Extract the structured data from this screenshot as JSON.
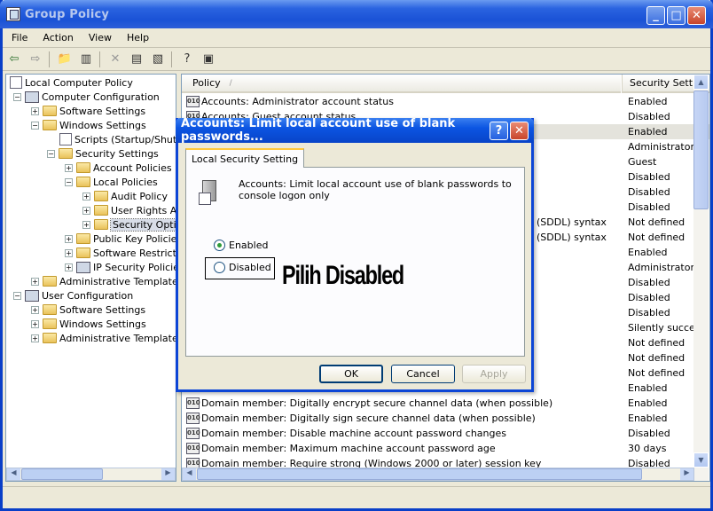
{
  "window": {
    "title": "Group Policy"
  },
  "menu": [
    "File",
    "Action",
    "View",
    "Help"
  ],
  "tree": [
    {
      "label": "Local Computer Policy",
      "icon": "policy-icon"
    },
    {
      "label": "Computer Configuration",
      "icon": "computer-icon"
    },
    {
      "label": "Software Settings",
      "icon": "folder-icon"
    },
    {
      "label": "Windows Settings",
      "icon": "folder-icon"
    },
    {
      "label": "Scripts (Startup/Shutdo",
      "icon": "scripts-icon"
    },
    {
      "label": "Security Settings",
      "icon": "security-folder-icon"
    },
    {
      "label": "Account Policies",
      "icon": "folder-icon"
    },
    {
      "label": "Local Policies",
      "icon": "folder-icon"
    },
    {
      "label": "Audit Policy",
      "icon": "folder-icon"
    },
    {
      "label": "User Rights Ass",
      "icon": "folder-icon"
    },
    {
      "label": "Security Option",
      "icon": "folder-icon"
    },
    {
      "label": "Public Key Policies",
      "icon": "folder-icon"
    },
    {
      "label": "Software Restrictic",
      "icon": "folder-icon"
    },
    {
      "label": "IP Security Policies",
      "icon": "ip-security-icon"
    },
    {
      "label": "Administrative Templates",
      "icon": "folder-icon"
    },
    {
      "label": "User Configuration",
      "icon": "user-icon"
    },
    {
      "label": "Software Settings",
      "icon": "folder-icon"
    },
    {
      "label": "Windows Settings",
      "icon": "folder-icon"
    },
    {
      "label": "Administrative Templates",
      "icon": "folder-icon"
    }
  ],
  "list": {
    "col_policy": "Policy",
    "col_setting": "Security Settin",
    "rows": [
      {
        "policy": "Accounts: Administrator account status",
        "setting": "Enabled"
      },
      {
        "policy": "Accounts: Guest account status",
        "setting": "Disabled"
      },
      {
        "policy": "",
        "setting": "Enabled"
      },
      {
        "policy": "",
        "setting": "Administrator"
      },
      {
        "policy": "",
        "setting": "Guest"
      },
      {
        "policy": "",
        "setting": "Disabled"
      },
      {
        "policy": "",
        "setting": "Disabled"
      },
      {
        "policy": "",
        "setting": "Disabled"
      },
      {
        "policy": "(SDDL) syntax",
        "setting": "Not defined"
      },
      {
        "policy": "(SDDL) syntax",
        "setting": "Not defined"
      },
      {
        "policy": "",
        "setting": "Enabled"
      },
      {
        "policy": "",
        "setting": "Administrators"
      },
      {
        "policy": "",
        "setting": "Disabled"
      },
      {
        "policy": "",
        "setting": "Disabled"
      },
      {
        "policy": "",
        "setting": "Disabled"
      },
      {
        "policy": "",
        "setting": "Silently succeed"
      },
      {
        "policy": "",
        "setting": "Not defined"
      },
      {
        "policy": "",
        "setting": "Not defined"
      },
      {
        "policy": "",
        "setting": "Not defined"
      },
      {
        "policy": "",
        "setting": "Enabled"
      },
      {
        "policy": "Domain member: Digitally encrypt secure channel data (when possible)",
        "setting": "Enabled"
      },
      {
        "policy": "Domain member: Digitally sign secure channel data (when possible)",
        "setting": "Enabled"
      },
      {
        "policy": "Domain member: Disable machine account password changes",
        "setting": "Disabled"
      },
      {
        "policy": "Domain member: Maximum machine account password age",
        "setting": "30 days"
      },
      {
        "policy": "Domain member: Require strong (Windows 2000 or later) session key",
        "setting": "Disabled"
      }
    ]
  },
  "dialog": {
    "title": "Accounts: Limit local account use of blank passwords...",
    "tab": "Local Security Setting",
    "description": "Accounts: Limit local account use of blank passwords to console logon only",
    "enabled_label": "Enabled",
    "disabled_label": "Disabled",
    "selected": "Enabled",
    "ok": "OK",
    "cancel": "Cancel",
    "apply": "Apply"
  },
  "annotation": "Pilih Disabled"
}
